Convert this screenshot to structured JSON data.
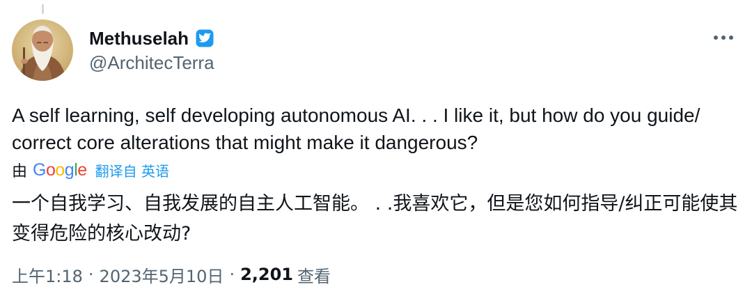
{
  "author": {
    "display_name": "Methuselah",
    "handle": "@ArchitecTerra",
    "verified": true
  },
  "tweet": {
    "text": "A self learning, self developing autonomous AI. . . I like it, but how do you guide/ correct core alterations that might make it dangerous?"
  },
  "translation": {
    "by_label": "由",
    "provider_letters": [
      "G",
      "o",
      "o",
      "g",
      "l",
      "e"
    ],
    "from_label": "翻译自 英语",
    "text": "一个自我学习、自我发展的自主人工智能。 . .我喜欢它，但是您如何指导/纠正可能使其变得危险的核心改动?"
  },
  "meta": {
    "time": "上午1:18",
    "separator": "·",
    "date": "2023年5月10日",
    "views_count": "2,201",
    "views_label": "查看"
  },
  "colors": {
    "accent": "#1d9bf0",
    "secondary_text": "#536471",
    "primary_text": "#0f1419"
  },
  "icons": {
    "verified": "verified-badge-icon",
    "more": "more-options-icon"
  }
}
